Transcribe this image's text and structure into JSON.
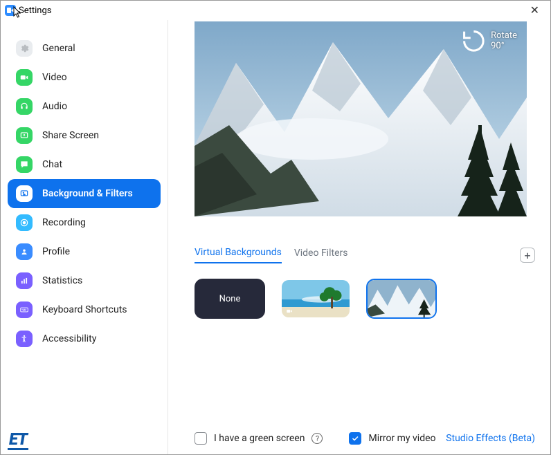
{
  "titlebar": {
    "title": "Settings"
  },
  "sidebar": {
    "items": [
      {
        "label": "General"
      },
      {
        "label": "Video"
      },
      {
        "label": "Audio"
      },
      {
        "label": "Share Screen"
      },
      {
        "label": "Chat"
      },
      {
        "label": "Background & Filters",
        "active": true
      },
      {
        "label": "Recording"
      },
      {
        "label": "Profile"
      },
      {
        "label": "Statistics"
      },
      {
        "label": "Keyboard Shortcuts"
      },
      {
        "label": "Accessibility"
      }
    ]
  },
  "preview": {
    "rotate_label": "Rotate 90°"
  },
  "tabs": {
    "virtual_backgrounds": "Virtual Backgrounds",
    "video_filters": "Video Filters"
  },
  "thumbs": {
    "none_label": "None"
  },
  "footer": {
    "green_screen_label": "I have a green screen",
    "mirror_label": "Mirror my video",
    "studio_effects_label": "Studio Effects (Beta)"
  },
  "watermark": "ET"
}
